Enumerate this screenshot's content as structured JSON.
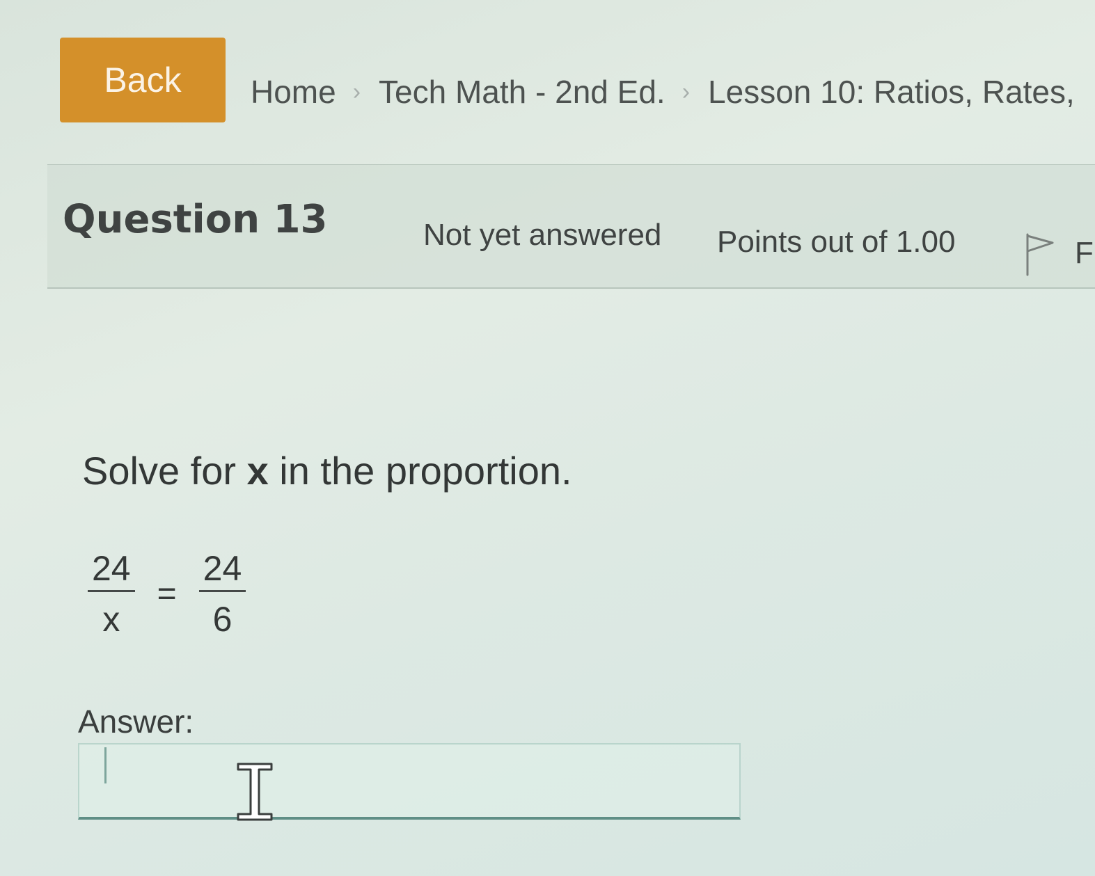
{
  "nav": {
    "back_label": "Back",
    "breadcrumb": [
      "Home",
      "Tech Math - 2nd Ed.",
      "Lesson 10: Ratios, Rates,"
    ],
    "separator": "›"
  },
  "question": {
    "number_label": "Question 13",
    "status": "Not yet answered",
    "points": "Points out of 1.00",
    "flag_label": "F",
    "flag_icon": "flag-outline-icon"
  },
  "body": {
    "prompt_before": "Solve for ",
    "prompt_variable": "x",
    "prompt_after": " in the proportion.",
    "equation": {
      "left_numerator": "24",
      "left_denominator": "x",
      "operator": "=",
      "right_numerator": "24",
      "right_denominator": "6"
    },
    "answer_label": "Answer:",
    "answer_value": ""
  },
  "colors": {
    "back_button": "#d4902a",
    "input_underline": "#5f8f86"
  }
}
